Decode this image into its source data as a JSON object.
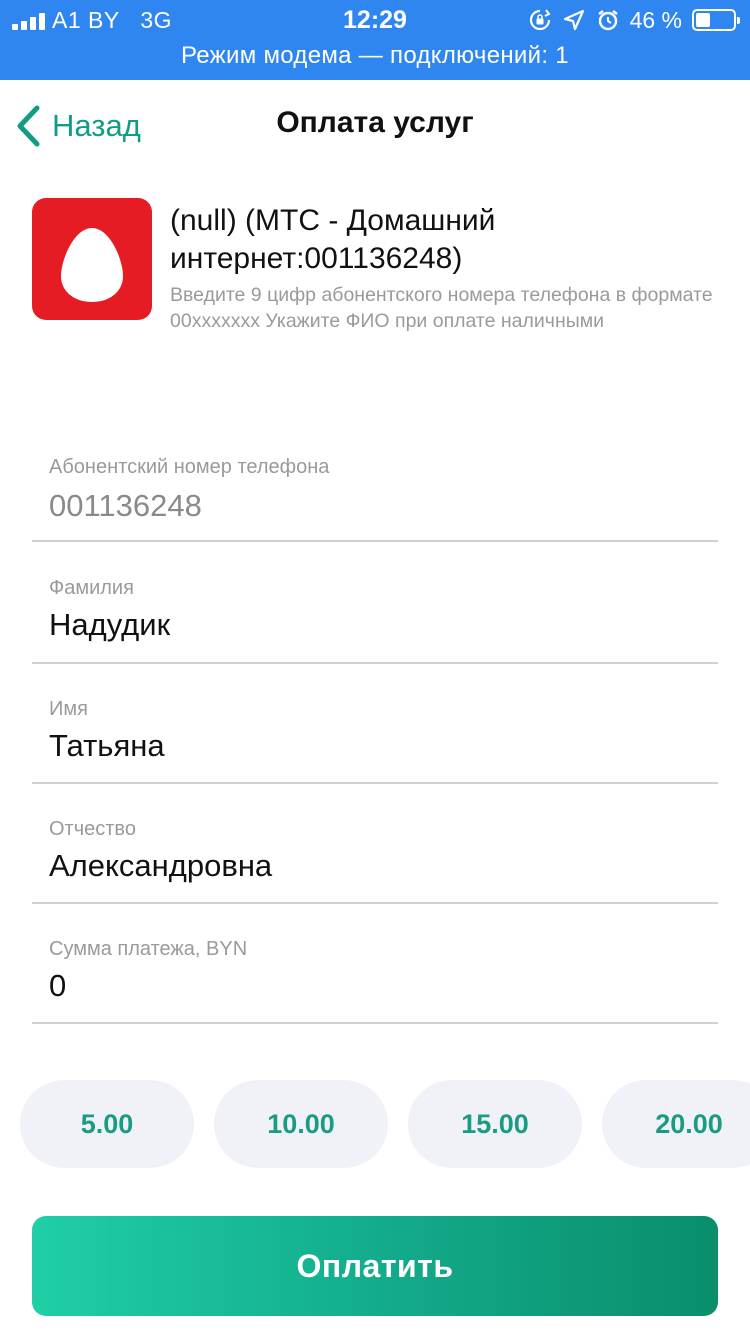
{
  "status_bar": {
    "carrier": "A1 BY",
    "network": "3G",
    "time": "12:29",
    "battery_percent": "46 %",
    "battery_level": 0.46,
    "hotspot_text": "Режим модема — подключений: 1",
    "icons": [
      "signal-icon",
      "orientation-lock-icon",
      "location-icon",
      "alarm-icon",
      "battery-icon"
    ],
    "background_color": "#2f86f0"
  },
  "navbar": {
    "back_label": "Назад",
    "title": "Оплата услуг",
    "accent_color": "#139c84"
  },
  "provider": {
    "logo_icon": "mts-egg-logo-icon",
    "logo_color": "#e51c24",
    "name": "(null) (МТС - Домашний интернет:001136248)",
    "hint": "Введите 9 цифр абонентского номера телефона в формате 00xxxxxxx Укажите ФИО при оплате наличными"
  },
  "form": {
    "phone": {
      "label": "Абонентский номер телефона",
      "value": "001136248"
    },
    "last_name": {
      "label": "Фамилия",
      "value": "Надудик"
    },
    "first_name": {
      "label": "Имя",
      "value": "Татьяна"
    },
    "patronymic": {
      "label": "Отчество",
      "value": "Александровна"
    },
    "amount": {
      "label": "Сумма платежа, BYN",
      "value": "0"
    }
  },
  "quick_amounts": [
    "5.00",
    "10.00",
    "15.00",
    "20.00"
  ],
  "pay_button": {
    "label": "Оплатить",
    "gradient_colors": [
      "#1fcfa6",
      "#0a8e6b"
    ]
  }
}
